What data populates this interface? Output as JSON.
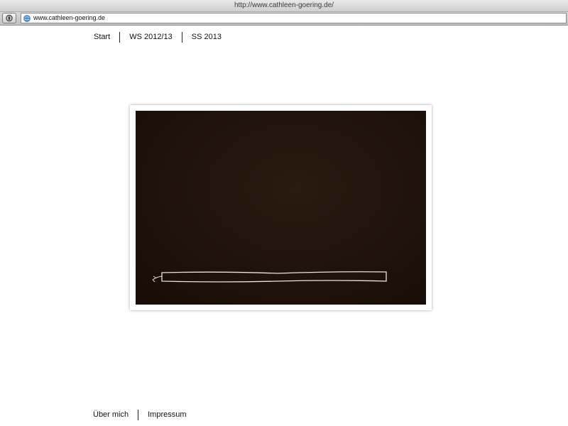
{
  "browser": {
    "title": "http://www.cathleen-goering.de/",
    "url": "www.cathleen-goering.de"
  },
  "nav": {
    "items": [
      {
        "label": "Start"
      },
      {
        "label": "WS 2012/13"
      },
      {
        "label": "SS 2013"
      }
    ]
  },
  "footer": {
    "items": [
      {
        "label": "Über mich"
      },
      {
        "label": "Impressum"
      }
    ]
  },
  "colors": {
    "photo_background": "#1f1209",
    "line_drawing": "#e8e6d8"
  }
}
